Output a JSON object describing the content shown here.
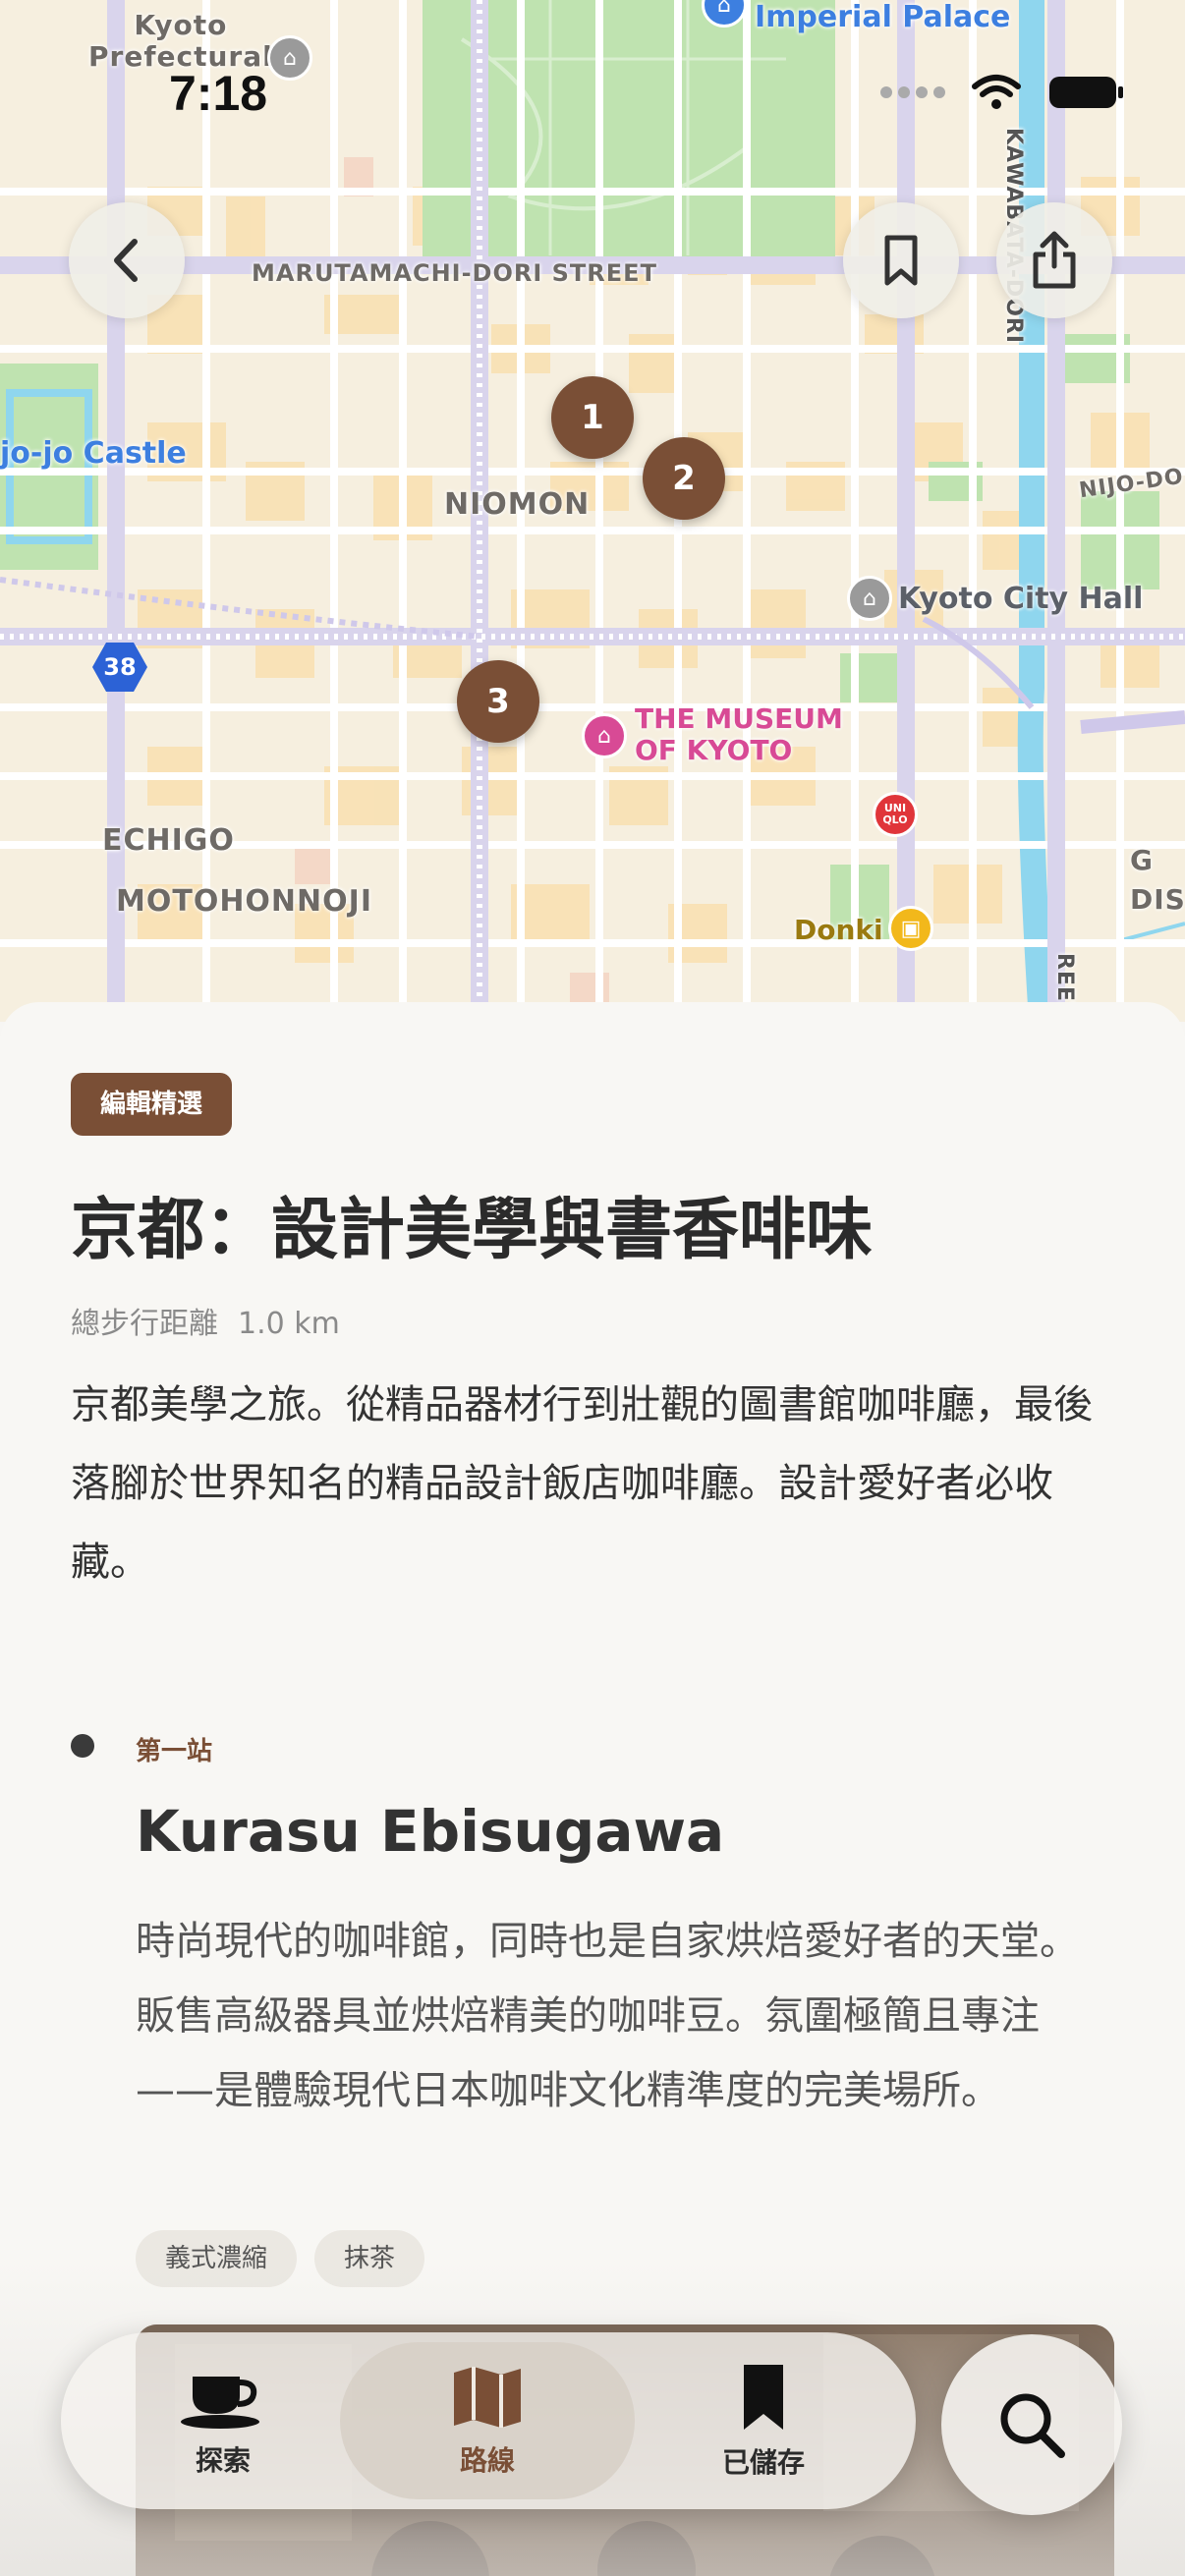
{
  "status_bar": {
    "time": "7:18"
  },
  "map": {
    "labels": {
      "kyoto_prefectural": "Kyoto\nPrefectural",
      "imperial_palace": "Imperial Palace",
      "marutamachi": "MARUTAMACHI-DORI STREET",
      "nijo_castle": "jo-jo Castle",
      "niomon": "NIOMON",
      "nijo_dori": "NIJO-DO",
      "kyoto_city_hall": "Kyoto City Hall",
      "route_38": "38",
      "museum": "THE MUSEUM\nOF KYOTO",
      "echigo": "ECHIGO",
      "motohonnoji": "MOTOHONNOJI",
      "uniqlo": "UNI\nQLO",
      "donki": "Donki",
      "g_dis": "G\nDIS",
      "kawabata": "KAWABATA-DORI",
      "street_right": "REET"
    },
    "markers": [
      "1",
      "2",
      "3"
    ]
  },
  "header_buttons": {
    "back": "back-icon",
    "bookmark": "bookmark-icon",
    "share": "share-icon"
  },
  "sheet": {
    "badge": "編輯精選",
    "title": "京都：設計美學與書香啡味",
    "distance_label": "總步行距離",
    "distance_value": "1.0 km",
    "description": "京都美學之旅。從精品器材行到壯觀的圖書館咖啡廳，最後落腳於世界知名的精品設計飯店咖啡廳。設計愛好者必收藏。",
    "stop": {
      "label": "第一站",
      "name": "Kurasu Ebisugawa",
      "description": "時尚現代的咖啡館，同時也是自家烘焙愛好者的天堂。販售高級器具並烘焙精美的咖啡豆。氛圍極簡且專注——是體驗現代日本咖啡文化精準度的完美場所。",
      "tags": [
        "義式濃縮",
        "抹茶"
      ]
    }
  },
  "tabbar": {
    "tabs": [
      {
        "label": "探索",
        "icon": "coffee-cup-icon"
      },
      {
        "label": "路線",
        "icon": "map-icon",
        "active": true
      },
      {
        "label": "已儲存",
        "icon": "bookmark-icon"
      }
    ],
    "search_icon": "search-icon"
  },
  "colors": {
    "accent": "#7a4f36",
    "park": "#bfe3b0",
    "water": "#8fd6ee",
    "poi_pink": "#d84a95",
    "poi_blue": "#3d7fe0"
  }
}
